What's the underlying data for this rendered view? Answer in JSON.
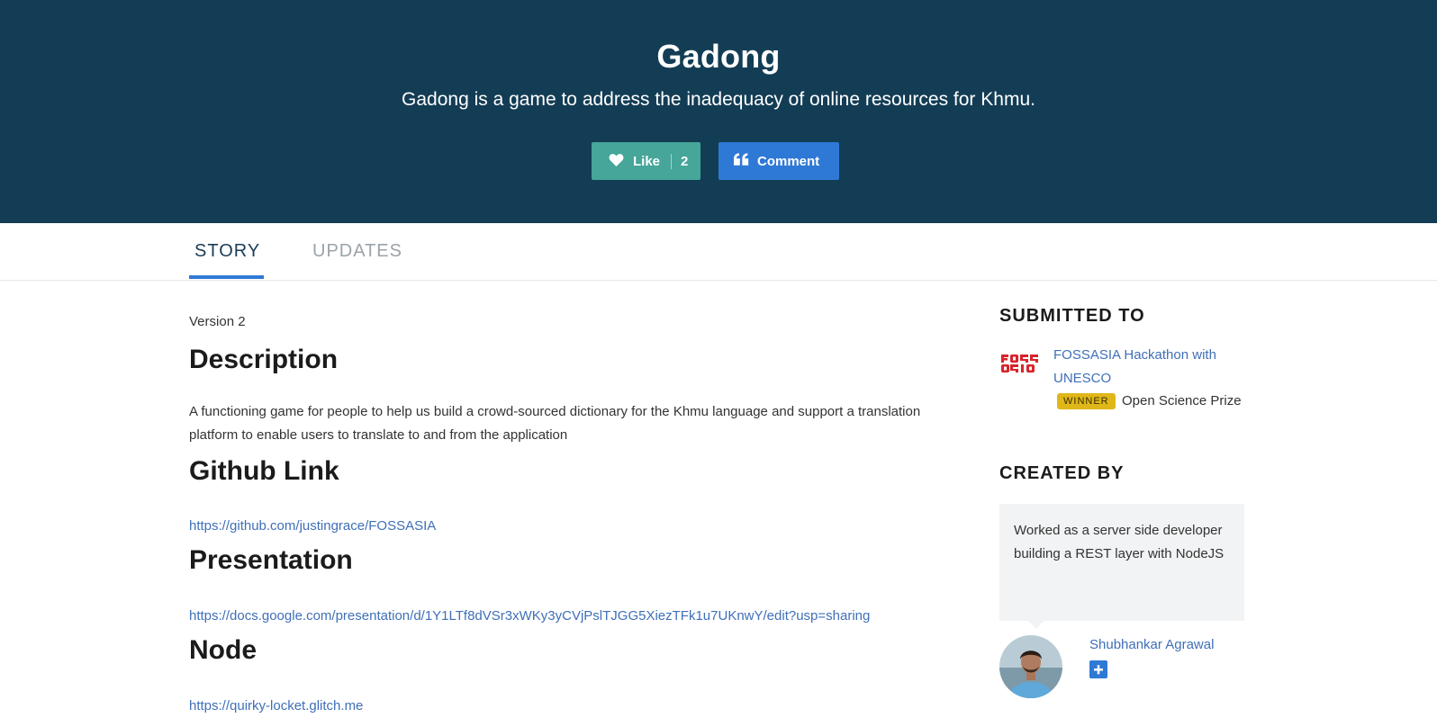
{
  "hero": {
    "title": "Gadong",
    "tagline": "Gadong is a game to address the inadequacy of online resources for Khmu.",
    "like_label": "Like",
    "like_count": "2",
    "comment_label": "Comment"
  },
  "tabs": {
    "story": "STORY",
    "updates": "UPDATES",
    "active": "STORY"
  },
  "story": {
    "version": "Version 2",
    "description_heading": "Description",
    "description_text": "A functioning game for people to help us build a crowd-sourced dictionary for the Khmu language and support a translation platform to enable users to translate to and from the application",
    "github_heading": "Github Link",
    "github_url": "https://github.com/justingrace/FOSSASIA",
    "presentation_heading": "Presentation",
    "presentation_url": "https://docs.google.com/presentation/d/1Y1LTf8dVSr3xWKy3yCVjPslTJGG5XiezTFk1u7UKnwY/edit?usp=sharing",
    "node_heading": "Node",
    "node_url": "https://quirky-locket.glitch.me"
  },
  "sidebar": {
    "submitted_heading": "SUBMITTED TO",
    "hackathon_name": "FOSSASIA Hackathon with UNESCO",
    "winner_badge": "WINNER",
    "prize_name": "Open Science Prize",
    "created_heading": "CREATED BY",
    "creator_bio": "Worked as a server side developer building a REST layer with NodeJS",
    "creator_name": "Shubhankar Agrawal"
  },
  "colors": {
    "hero_bg": "#133d55",
    "like_bg": "#45a699",
    "comment_bg": "#2f79d6",
    "link": "#3f6fb8",
    "winner_badge": "#e0b718",
    "fossasia_red": "#d8232a"
  },
  "icons": {
    "like": "heart-icon",
    "comment": "quote-icon",
    "follow": "plus-icon",
    "hackathon_logo": "fossasia-logo"
  }
}
